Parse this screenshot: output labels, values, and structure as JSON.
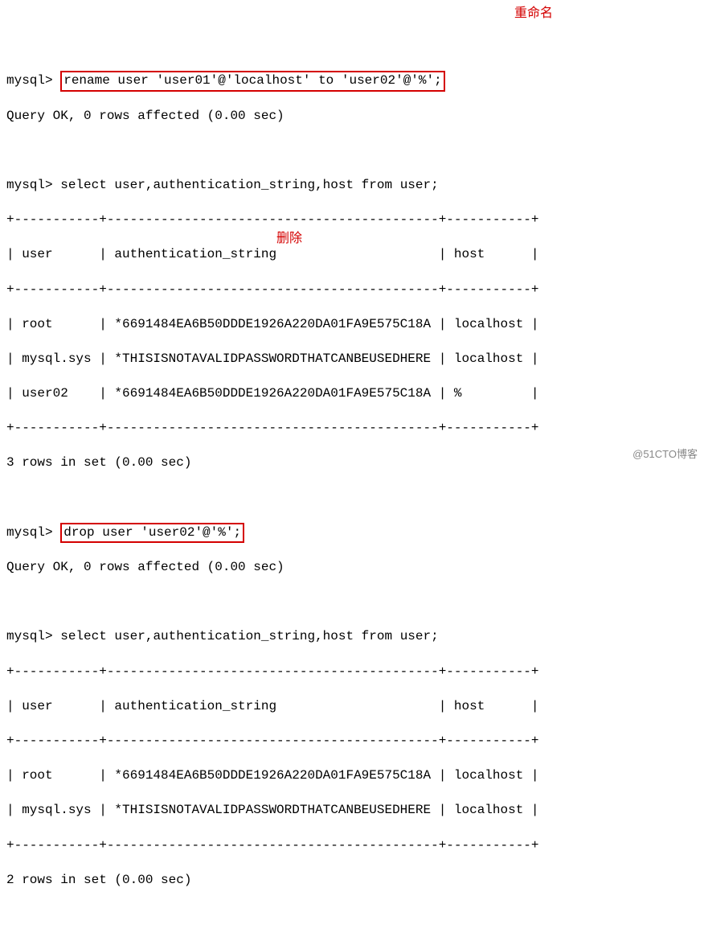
{
  "prompt": "mysql>",
  "commands": {
    "rename": "rename user 'user01'@'localhost' to 'user02'@'%';",
    "drop": "drop user 'user02'@'%';",
    "select": "select user,authentication_string,host from user;"
  },
  "annotations": {
    "rename_label": "重命名",
    "drop_label": "删除"
  },
  "query_ok": "Query OK, 0 rows affected (0.00 sec)",
  "tables": {
    "border": "+-----------+-------------------------------------------+-----------+",
    "header_row": "| user      | authentication_string                     | host      |",
    "rows1": [
      "| root      | *6691484EA6B50DDDE1926A220DA01FA9E575C18A | localhost |",
      "| mysql.sys | *THISISNOTAVALIDPASSWORDTHATCANBEUSEDHERE | localhost |",
      "| user02    | *6691484EA6B50DDDE1926A220DA01FA9E575C18A | %         |"
    ],
    "rows2": [
      "| root      | *6691484EA6B50DDDE1926A220DA01FA9E575C18A | localhost |",
      "| mysql.sys | *THISISNOTAVALIDPASSWORDTHATCANBEUSEDHERE | localhost |"
    ],
    "count1": "3 rows in set (0.00 sec)",
    "count2": "2 rows in set (0.00 sec)"
  },
  "watermark": "@51CTO博客"
}
